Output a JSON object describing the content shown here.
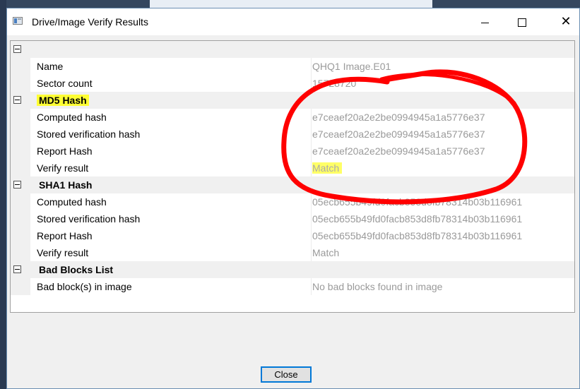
{
  "window": {
    "title": "Drive/Image Verify Results",
    "minimize_glyph": "",
    "maximize_glyph": "",
    "close_glyph": "✕"
  },
  "grid": {
    "top_row": {
      "collapsed": false
    },
    "properties": [
      {
        "name": "Name",
        "value": "QHQ1 Image.E01"
      },
      {
        "name": "Sector count",
        "value": "15728720"
      }
    ],
    "md5": {
      "label": "MD5 Hash",
      "rows": [
        {
          "name": "Computed hash",
          "value": "e7ceaef20a2e2be0994945a1a5776e37"
        },
        {
          "name": "Stored verification hash",
          "value": "e7ceaef20a2e2be0994945a1a5776e37"
        },
        {
          "name": "Report Hash",
          "value": "e7ceaef20a2e2be0994945a1a5776e37"
        },
        {
          "name": "Verify result",
          "value": "Match"
        }
      ]
    },
    "sha1": {
      "label": "SHA1 Hash",
      "rows": [
        {
          "name": "Computed hash",
          "value": "05ecb655b49fd0facb853d8fb78314b03b116961"
        },
        {
          "name": "Stored verification hash",
          "value": "05ecb655b49fd0facb853d8fb78314b03b116961"
        },
        {
          "name": "Report Hash",
          "value": "05ecb655b49fd0facb853d8fb78314b03b116961"
        },
        {
          "name": "Verify result",
          "value": "Match"
        }
      ]
    },
    "bad_blocks": {
      "label": "Bad Blocks List",
      "rows": [
        {
          "name": "Bad block(s) in image",
          "value": "No bad blocks found in image"
        }
      ]
    }
  },
  "buttons": {
    "close_label": "Close"
  },
  "colors": {
    "highlight": "#ffff33",
    "annotation": "#ff0000",
    "accent": "#0078d7"
  }
}
